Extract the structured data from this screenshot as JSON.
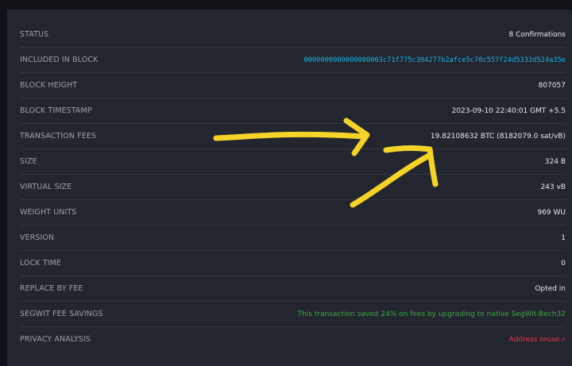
{
  "details": {
    "status": {
      "label": "STATUS",
      "value": "8 Confirmations"
    },
    "included_in_block": {
      "label": "INCLUDED IN BLOCK",
      "value": "0000000000000000003c71f775c304277b2afce5c70c557f24d5333d524a35e"
    },
    "block_height": {
      "label": "BLOCK HEIGHT",
      "value": "807057"
    },
    "block_timestamp": {
      "label": "BLOCK TIMESTAMP",
      "value": "2023-09-10 22:40:01 GMT +5.5"
    },
    "transaction_fees": {
      "label": "TRANSACTION FEES",
      "value": "19.82108632 BTC (8182079.0 sat/vB)"
    },
    "size": {
      "label": "SIZE",
      "value": "324 B"
    },
    "virtual_size": {
      "label": "VIRTUAL SIZE",
      "value": "243 vB"
    },
    "weight_units": {
      "label": "WEIGHT UNITS",
      "value": "969 WU"
    },
    "version": {
      "label": "VERSION",
      "value": "1"
    },
    "lock_time": {
      "label": "LOCK TIME",
      "value": "0"
    },
    "replace_by_fee": {
      "label": "REPLACE BY FEE",
      "value": "Opted in"
    },
    "segwit_fee_savings": {
      "label": "SEGWIT FEE SAVINGS",
      "value": "This transaction saved 24% on fees by upgrading to native SegWit-Bech32"
    },
    "privacy_analysis": {
      "label": "PRIVACY ANALYSIS",
      "value": "Address reuse",
      "icon": "external-link-icon"
    }
  },
  "colors": {
    "link": "#1bb3e8",
    "success": "#3ca745",
    "danger": "#e6384b",
    "annotation_arrows": "#f5d328"
  }
}
